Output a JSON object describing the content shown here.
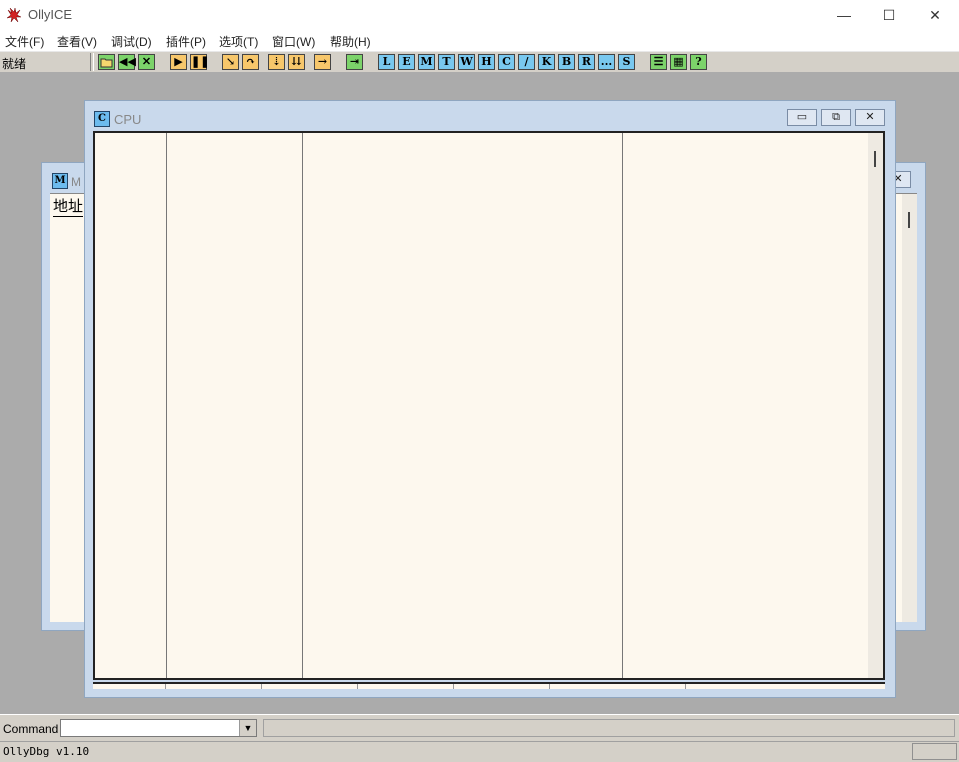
{
  "window": {
    "title": "OllyICE"
  },
  "menu": [
    "文件(F)",
    "查看(V)",
    "调试(D)",
    "插件(P)",
    "选项(T)",
    "窗口(W)",
    "帮助(H)"
  ],
  "toolbar": {
    "status": "就绪",
    "letter_buttons": [
      "L",
      "E",
      "M",
      "T",
      "W",
      "H",
      "C",
      "/",
      "K",
      "B",
      "R",
      "...",
      "S"
    ],
    "help_label": "?"
  },
  "memory_window": {
    "title": "M",
    "icon_letter": "M",
    "column_address": "地址"
  },
  "cpu_window": {
    "title": "CPU",
    "icon_letter": "C"
  },
  "command": {
    "label": "Command :",
    "value": ""
  },
  "status": {
    "text": "OllyDbg v1.10"
  }
}
